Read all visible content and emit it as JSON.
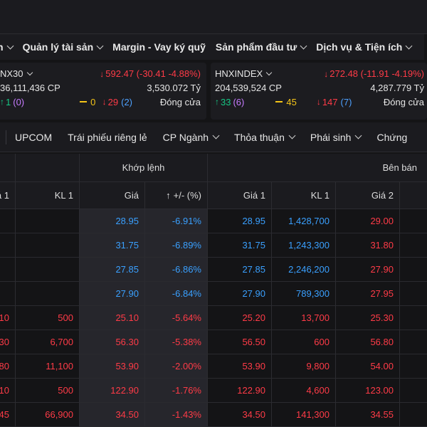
{
  "main_menu": [
    {
      "label": "n",
      "chevron": true
    },
    {
      "label": "Quản lý tài sản",
      "chevron": true
    },
    {
      "label": "Margin - Vay ký quỹ",
      "chevron": false
    },
    {
      "label": "Sản phẩm đầu tư",
      "chevron": true
    },
    {
      "label": "Dịch vụ & Tiện ích",
      "chevron": true
    }
  ],
  "indices": {
    "left": {
      "name": "NX30",
      "change": "592.47 (-30.41 -4.88%)",
      "volume": "36,111,436 CP",
      "value": "3,530.072 Tỷ",
      "up": "1",
      "up_ceiling": "(0)",
      "ref": "0",
      "down": "29",
      "down_floor": "(2)",
      "status": "Đóng cửa"
    },
    "right": {
      "name": "HNXINDEX",
      "change": "272.48 (-11.91 -4.19%)",
      "volume": "204,539,524 CP",
      "value": "4,287.779 Tỷ",
      "up": "33",
      "up_ceiling": "(6)",
      "ref": "45",
      "down": "147",
      "down_floor": "(7)",
      "status": "Đóng cửa"
    }
  },
  "tabs": [
    {
      "label": "UPCOM",
      "chevron": false
    },
    {
      "label": "Trái phiếu riêng lẻ",
      "chevron": false
    },
    {
      "label": "CP Ngành",
      "chevron": true
    },
    {
      "label": "Thỏa thuận",
      "chevron": true
    },
    {
      "label": "Phái sinh",
      "chevron": true
    },
    {
      "label": "Chứng",
      "chevron": false
    }
  ],
  "table": {
    "group_headers": {
      "khop": "Khớp lệnh",
      "ban": "Bên bán"
    },
    "col_headers": {
      "gia1_buy": "iá 1",
      "kl1_buy": "KL 1",
      "gia": "Giá",
      "change_pct": "+/- (%)",
      "gia1_sell": "Giá 1",
      "kl1_sell": "KL 1",
      "gia2_sell": "Giá 2"
    },
    "rows": [
      {
        "gia1_buy": "",
        "kl1_buy": "",
        "gia": "28.95",
        "pct": "-6.91%",
        "gia1_sell": "28.95",
        "kl1_sell": "1,428,700",
        "gia2_sell": "29.00",
        "kc": "floor",
        "s1c": "floor",
        "s2c": "down",
        "bc": "down"
      },
      {
        "gia1_buy": "",
        "kl1_buy": "",
        "gia": "31.75",
        "pct": "-6.89%",
        "gia1_sell": "31.75",
        "kl1_sell": "1,243,300",
        "gia2_sell": "31.80",
        "kc": "floor",
        "s1c": "floor",
        "s2c": "down",
        "bc": "down"
      },
      {
        "gia1_buy": "",
        "kl1_buy": "",
        "gia": "27.85",
        "pct": "-6.86%",
        "gia1_sell": "27.85",
        "kl1_sell": "2,246,200",
        "gia2_sell": "27.90",
        "kc": "floor",
        "s1c": "floor",
        "s2c": "down",
        "bc": "down"
      },
      {
        "gia1_buy": "",
        "kl1_buy": "",
        "gia": "27.90",
        "pct": "-6.84%",
        "gia1_sell": "27.90",
        "kl1_sell": "789,300",
        "gia2_sell": "27.95",
        "kc": "floor",
        "s1c": "floor",
        "s2c": "down",
        "bc": "down"
      },
      {
        "gia1_buy": "10",
        "kl1_buy": "500",
        "gia": "25.10",
        "pct": "-5.64%",
        "gia1_sell": "25.20",
        "kl1_sell": "13,700",
        "gia2_sell": "25.30",
        "kc": "down",
        "s1c": "down",
        "s2c": "down",
        "bc": "down"
      },
      {
        "gia1_buy": "30",
        "kl1_buy": "6,700",
        "gia": "56.30",
        "pct": "-5.38%",
        "gia1_sell": "56.50",
        "kl1_sell": "600",
        "gia2_sell": "56.80",
        "kc": "down",
        "s1c": "down",
        "s2c": "down",
        "bc": "down"
      },
      {
        "gia1_buy": "80",
        "kl1_buy": "11,100",
        "gia": "53.90",
        "pct": "-2.00%",
        "gia1_sell": "53.90",
        "kl1_sell": "9,800",
        "gia2_sell": "54.00",
        "kc": "down",
        "s1c": "down",
        "s2c": "down",
        "bc": "down"
      },
      {
        "gia1_buy": "10",
        "kl1_buy": "500",
        "gia": "122.90",
        "pct": "-1.76%",
        "gia1_sell": "122.90",
        "kl1_sell": "4,600",
        "gia2_sell": "123.00",
        "kc": "down",
        "s1c": "down",
        "s2c": "down",
        "bc": "down"
      },
      {
        "gia1_buy": "45",
        "kl1_buy": "66,900",
        "gia": "34.50",
        "pct": "-1.43%",
        "gia1_sell": "34.50",
        "kl1_sell": "141,300",
        "gia2_sell": "34.55",
        "kc": "down",
        "s1c": "down",
        "s2c": "down",
        "bc": "down"
      }
    ]
  },
  "colors": {
    "up": "#16c784",
    "down": "#ff3b47",
    "floor": "#3aa0ff",
    "ref": "#f5c518",
    "ceiling": "#c67cff"
  }
}
